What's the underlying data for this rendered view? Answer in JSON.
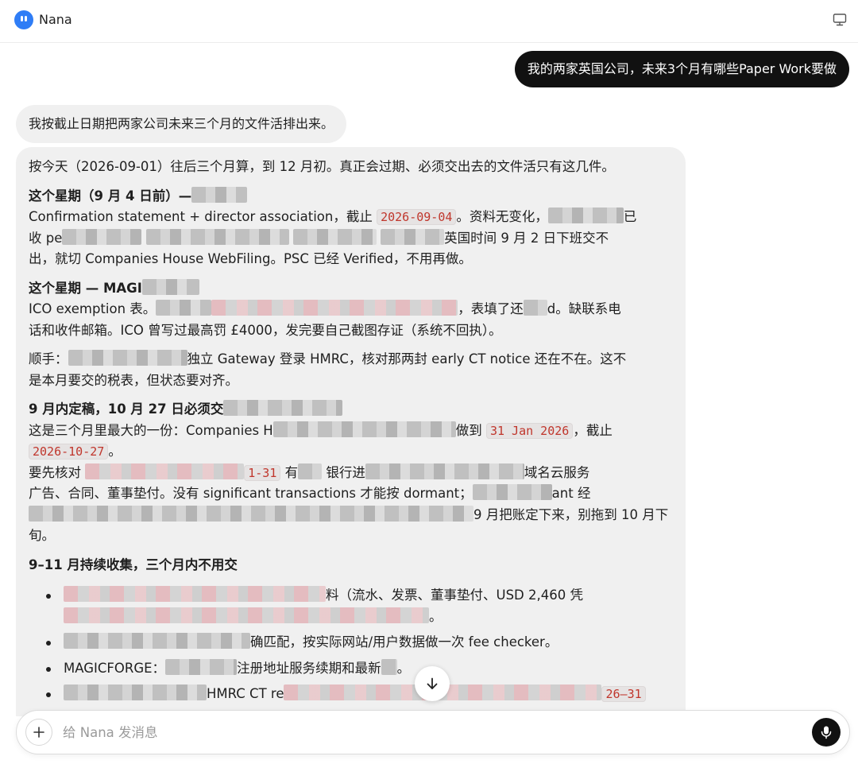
{
  "app": {
    "title": "Nana"
  },
  "user_message": "我的两家英国公司，未来3个月有哪些Paper Work要做",
  "assistant_intro": "我按截止日期把两家公司未来三个月的文件活排出来。",
  "assistant": {
    "opening": "按今天（2026-09-01）往后三个月算，到 12 月初。真正会过期、必须交出去的文件活只有这几件。",
    "s1": {
      "heading": "这个星期（9 月 4 日前）—",
      "line1_a": "Confirmation statement + director association，截止 ",
      "code1": "2026-09-04",
      "line1_b": "。资料无变化，",
      "line1_c": "已",
      "line2_a": "收 pe",
      "line2_b": "英国时间 9 月 2 日下班交不",
      "line3": "出，就切 Companies House WebFiling。PSC 已经 Verified，不用再做。"
    },
    "s2": {
      "heading": "这个星期 — MAGI",
      "line1_a": "ICO exemption 表。",
      "line1_b": "，表填了还",
      "line1_c": "d。缺联系电",
      "line2": "话和收件邮箱。ICO 曾写过最高罚 £4000，发完要自己截图存证（系统不回执）。"
    },
    "s3": {
      "line1_a": "顺手：",
      "line1_b": "独立 Gateway 登录 HMRC，核对那两封 early CT notice 还在不在。这不",
      "line2": "是本月要交的税表，但状态要对齐。"
    },
    "s4": {
      "heading": "9 月内定稿，10 月 27 日必须交",
      "line1_a": "这是三个月里最大的一份：Companies H",
      "line1_b": "做到 ",
      "code1": "31 Jan 2026",
      "line1_c": "，截止",
      "code2": "2026-10-27",
      "line2_end": "。",
      "line3_a": "要先核对 ",
      "code3": "1-31",
      "line3_b": " 有",
      "line3_c": " 银行进",
      "line3_d": "域名云服务",
      "line4_a": "广告、合同、董事垫付。没有 significant transactions 才能按 dormant；",
      "line4_b": "ant 经",
      "line5_a": "9 月把账定下来，别拖到 10 月下旬。"
    },
    "s5": {
      "heading": "9–11 月持续收集，三个月内不用交",
      "b1_a": "料（流水、发票、董事垫付、USD 2,460 凭",
      "b1_b": "。",
      "b2_a": "确匹配，按实际网站/用户数据做一次 fee checker。",
      "b3_a": "MAGICFORGE：",
      "b3_b": "注册地址服务续期和最新",
      "b3_c": "。",
      "b4_a": "HMRC CT re",
      "b4_b": "26–31"
    }
  },
  "composer": {
    "placeholder": "给 Nana 发消息"
  },
  "icons": {
    "logo": "nana-logo-icon",
    "monitor": "monitor-icon",
    "plus": "plus-icon",
    "mic": "microphone-icon",
    "scroll": "arrow-down-icon"
  },
  "colors": {
    "accent": "#2f7df6",
    "user_bubble": "#111111",
    "assistant_bubble": "#f0f0f0",
    "code_text": "#c0362c"
  }
}
